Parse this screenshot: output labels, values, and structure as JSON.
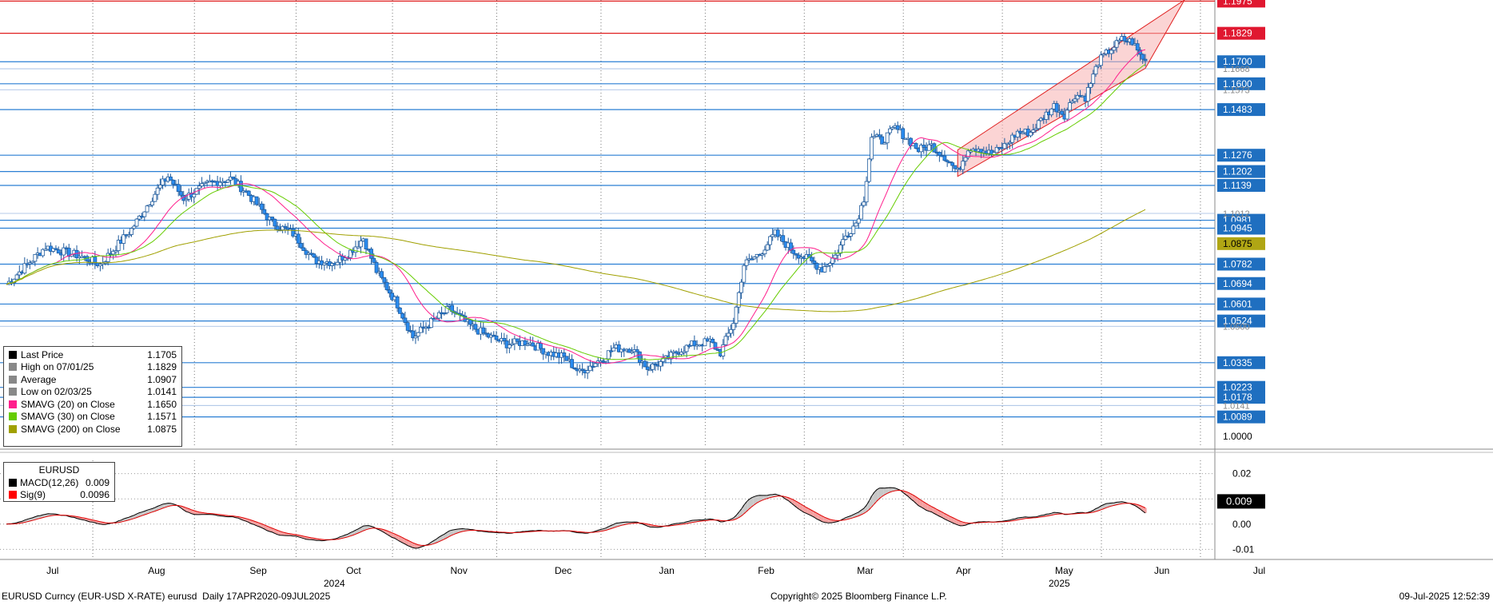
{
  "chart_data": {
    "type": "candlestick",
    "ticker": "EURUSD",
    "security": "EURUSD Curncy (EUR-USD X-RATE) eurusd",
    "period": "Daily 17APR2020-09JUL2025",
    "copyright": "Copyright© 2025 Bloomberg Finance L.P.",
    "timestamp": "09-Jul-2025 12:52:39",
    "y_range": [
      0.995,
      1.198
    ],
    "x_months": [
      "Jul",
      "Aug",
      "Sep",
      "Oct",
      "Nov",
      "Dec",
      "Jan",
      "Feb",
      "Mar",
      "Apr",
      "May",
      "Jun",
      "Jul"
    ],
    "x_years": [
      "2024",
      "2025"
    ],
    "price_axis_tick": "1.0000",
    "horizontal_levels": [
      "1.1975",
      "1.1829",
      "1.1700",
      "1.1600",
      "1.1483",
      "1.1276",
      "1.1202",
      "1.1139",
      "1.0981",
      "1.0945",
      "1.0875",
      "1.0782",
      "1.0694",
      "1.0601",
      "1.0524",
      "1.0335",
      "1.0223",
      "1.0178",
      "1.0089"
    ],
    "partially_hidden_levels": [
      "1.1668",
      "1.1573",
      "1.1012",
      "1.0500",
      "1.0141"
    ],
    "legend": [
      {
        "name": "Last Price",
        "value": "1.1705",
        "color": "#000000"
      },
      {
        "name": "High on 07/01/25",
        "value": "1.1829",
        "color": "#888888"
      },
      {
        "name": "Average",
        "value": "1.0907",
        "color": "#888888"
      },
      {
        "name": "Low on 02/03/25",
        "value": "1.0141",
        "color": "#888888"
      },
      {
        "name": "SMAVG (20)  on Close",
        "value": "1.1650",
        "color": "#ff1e8c"
      },
      {
        "name": "SMAVG (30)  on Close",
        "value": "1.1571",
        "color": "#66cc00"
      },
      {
        "name": "SMAVG (200)  on Close",
        "value": "1.0875",
        "color": "#a0a000"
      }
    ],
    "macd_legend": {
      "title": "EURUSD",
      "items": [
        {
          "name": "MACD(12,26)",
          "value": "0.009",
          "color": "#000000"
        },
        {
          "name": "Sig(9)",
          "value": "0.0096",
          "color": "#ff0000"
        }
      ]
    },
    "macd_axis_ticks": [
      "0.02",
      "0.01",
      "0.00",
      "-0.01"
    ],
    "macd_last_label": "0.009",
    "series": {
      "closes_keypoints": [
        [
          0,
          1.069
        ],
        [
          15,
          1.086
        ],
        [
          28,
          1.082
        ],
        [
          36,
          1.078
        ],
        [
          48,
          1.094
        ],
        [
          58,
          1.112
        ],
        [
          62,
          1.118
        ],
        [
          68,
          1.108
        ],
        [
          78,
          1.115
        ],
        [
          86,
          1.117
        ],
        [
          92,
          1.111
        ],
        [
          102,
          1.097
        ],
        [
          110,
          1.092
        ],
        [
          118,
          1.08
        ],
        [
          126,
          1.079
        ],
        [
          132,
          1.084
        ],
        [
          137,
          1.09
        ],
        [
          142,
          1.075
        ],
        [
          150,
          1.06
        ],
        [
          156,
          1.045
        ],
        [
          163,
          1.052
        ],
        [
          170,
          1.058
        ],
        [
          177,
          1.051
        ],
        [
          184,
          1.046
        ],
        [
          192,
          1.042
        ],
        [
          200,
          1.043
        ],
        [
          208,
          1.038
        ],
        [
          214,
          1.036
        ],
        [
          220,
          1.029
        ],
        [
          228,
          1.035
        ],
        [
          233,
          1.04
        ],
        [
          240,
          1.04
        ],
        [
          246,
          1.031
        ],
        [
          252,
          1.034
        ],
        [
          258,
          1.039
        ],
        [
          264,
          1.042
        ],
        [
          270,
          1.043
        ],
        [
          274,
          1.038
        ],
        [
          279,
          1.052
        ],
        [
          283,
          1.078
        ],
        [
          289,
          1.083
        ],
        [
          295,
          1.092
        ],
        [
          302,
          1.084
        ],
        [
          308,
          1.08
        ],
        [
          313,
          1.076
        ],
        [
          318,
          1.082
        ],
        [
          322,
          1.091
        ],
        [
          326,
          1.097
        ],
        [
          329,
          1.108
        ],
        [
          332,
          1.136
        ],
        [
          336,
          1.134
        ],
        [
          341,
          1.14
        ],
        [
          345,
          1.136
        ],
        [
          350,
          1.13
        ],
        [
          355,
          1.132
        ],
        [
          360,
          1.127
        ],
        [
          365,
          1.12
        ],
        [
          369,
          1.131
        ],
        [
          373,
          1.131
        ],
        [
          378,
          1.128
        ],
        [
          383,
          1.132
        ],
        [
          388,
          1.138
        ],
        [
          393,
          1.138
        ],
        [
          398,
          1.145
        ],
        [
          402,
          1.15
        ],
        [
          406,
          1.146
        ],
        [
          410,
          1.155
        ],
        [
          414,
          1.154
        ],
        [
          419,
          1.17
        ],
        [
          424,
          1.176
        ],
        [
          428,
          1.18
        ],
        [
          432,
          1.179
        ],
        [
          435,
          1.173
        ],
        [
          437,
          1.1705
        ]
      ],
      "highlighted_channel": {
        "lower_start": [
          365,
          1.118
        ],
        "lower_end": [
          437,
          1.167
        ],
        "upper_start": [
          365,
          1.13
        ],
        "upper_end": [
          452,
          1.198
        ]
      }
    }
  }
}
